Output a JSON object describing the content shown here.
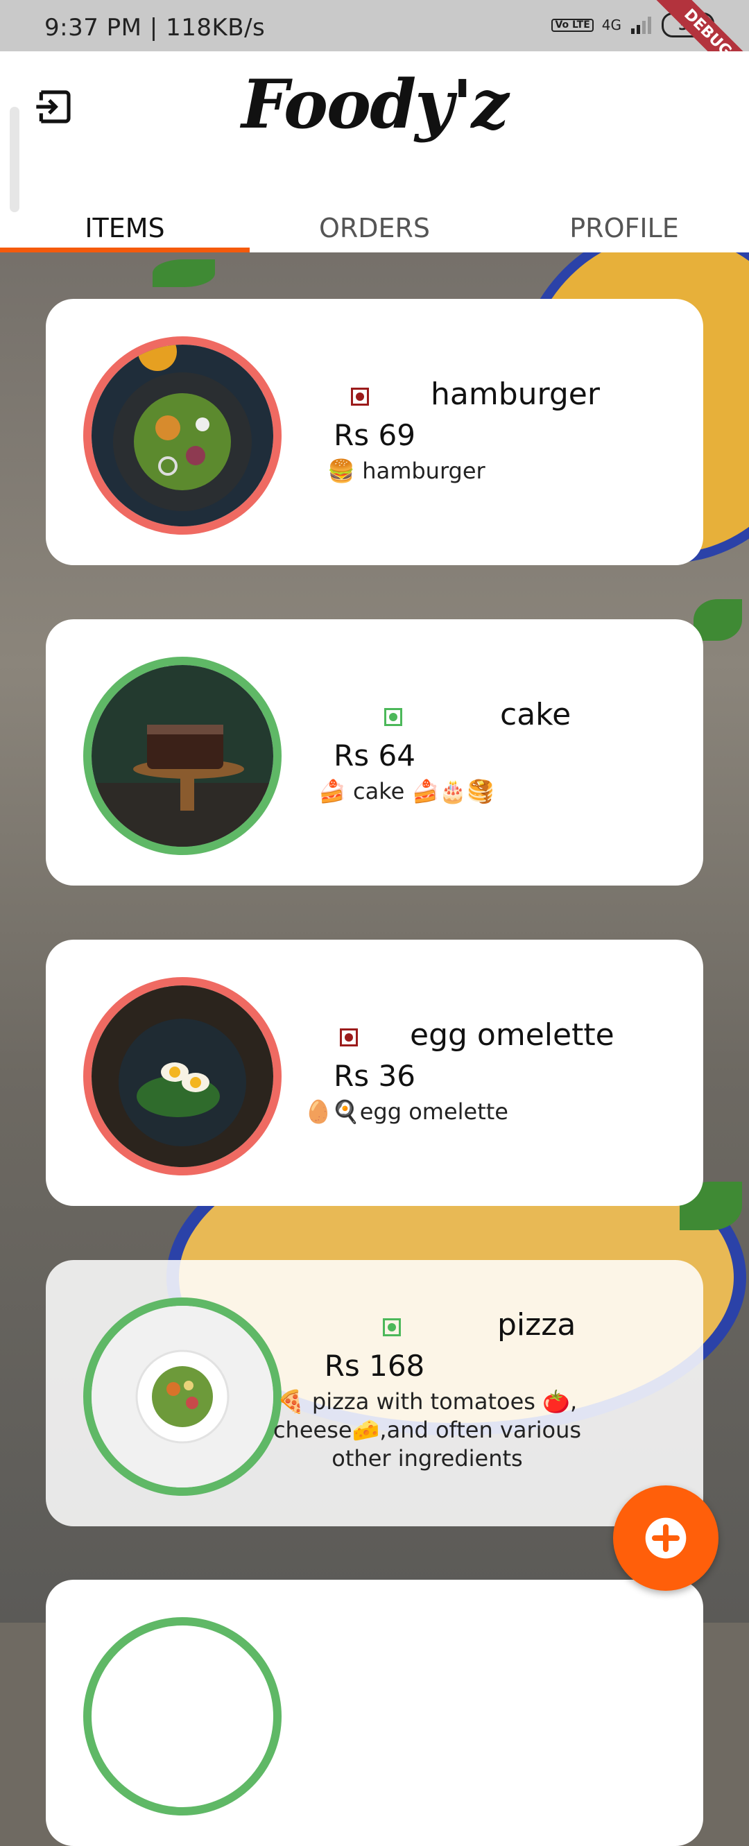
{
  "status_bar": {
    "time": "9:37 PM | 118KB/s",
    "network": "4G",
    "volte": "Vo LTE",
    "battery": "36",
    "debug_banner": "DEBUG"
  },
  "app": {
    "title": "Foody'z",
    "logout_icon": "logout-icon"
  },
  "tabs": [
    {
      "label": "ITEMS",
      "active": true
    },
    {
      "label": "ORDERS",
      "active": false
    },
    {
      "label": "PROFILE",
      "active": false
    }
  ],
  "items": [
    {
      "name": "hamburger",
      "price": "Rs 69",
      "description": "🍔 hamburger",
      "veg": false
    },
    {
      "name": "cake",
      "price": "Rs 64",
      "description": "🍰 cake 🍰🎂🥞",
      "veg": true
    },
    {
      "name": "egg omelette",
      "price": "Rs 36",
      "description": "🥚🍳egg omelette",
      "veg": false
    },
    {
      "name": "pizza",
      "price": "Rs 168",
      "description": "🍕 pizza with tomatoes 🍅, cheese🧀,and often various other ingredients",
      "veg": true
    }
  ],
  "colors": {
    "accent": "#f55a0c",
    "fab": "#ff5f0a",
    "nonveg_ring": "#ef6a62",
    "veg_ring": "#5fb866"
  },
  "fab": {
    "icon": "add-icon"
  }
}
